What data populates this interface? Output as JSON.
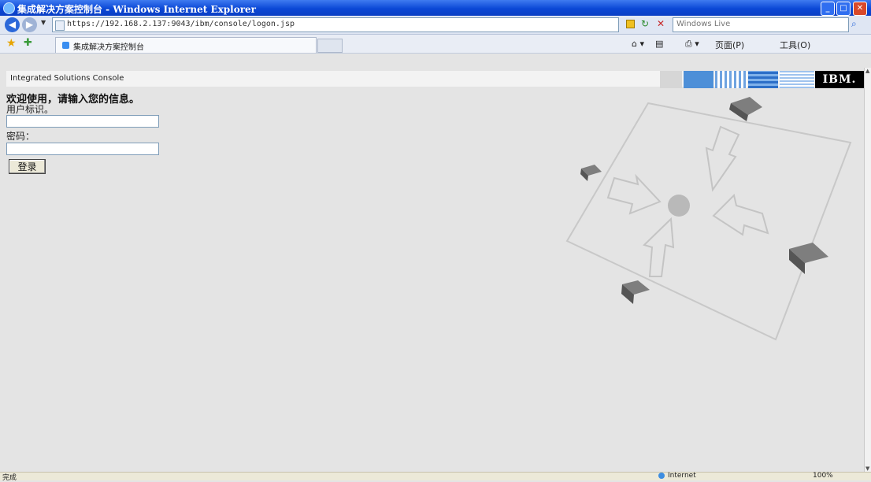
{
  "window": {
    "title": "集成解决方案控制台 - Windows Internet Explorer",
    "min_glyph": "_",
    "max_glyph": "□",
    "close_glyph": "✕"
  },
  "addressbar": {
    "url": "https://192.168.2.137:9043/ibm/console/logon.jsp",
    "search_placeholder": "Windows Live"
  },
  "favbar": {
    "tab_label": "集成解决方案控制台",
    "commands": [
      "页面(P)",
      "工具(O)"
    ]
  },
  "console": {
    "app_name": "Integrated Solutions Console",
    "logo": "IBM.",
    "welcome": "欢迎使用，请输入您的信息。",
    "userid_label": "用户标识。",
    "userid_value": "",
    "password_label": "密码：",
    "password_value": "",
    "login_button": "登录"
  },
  "status": {
    "text": "完成",
    "zone": "Internet",
    "zoom": "100%"
  },
  "colors": {
    "titlebar": "#0b48d6",
    "logo_bg": "#000000",
    "page_bg": "#e4e4e4"
  },
  "icons": [
    "ie-icon",
    "back-arrow-icon",
    "forward-arrow-icon",
    "lock-icon",
    "refresh-icon",
    "stop-icon",
    "search-icon",
    "favorites-star-icon",
    "add-favorite-icon",
    "page-icon",
    "home-icon",
    "globe-icon"
  ]
}
